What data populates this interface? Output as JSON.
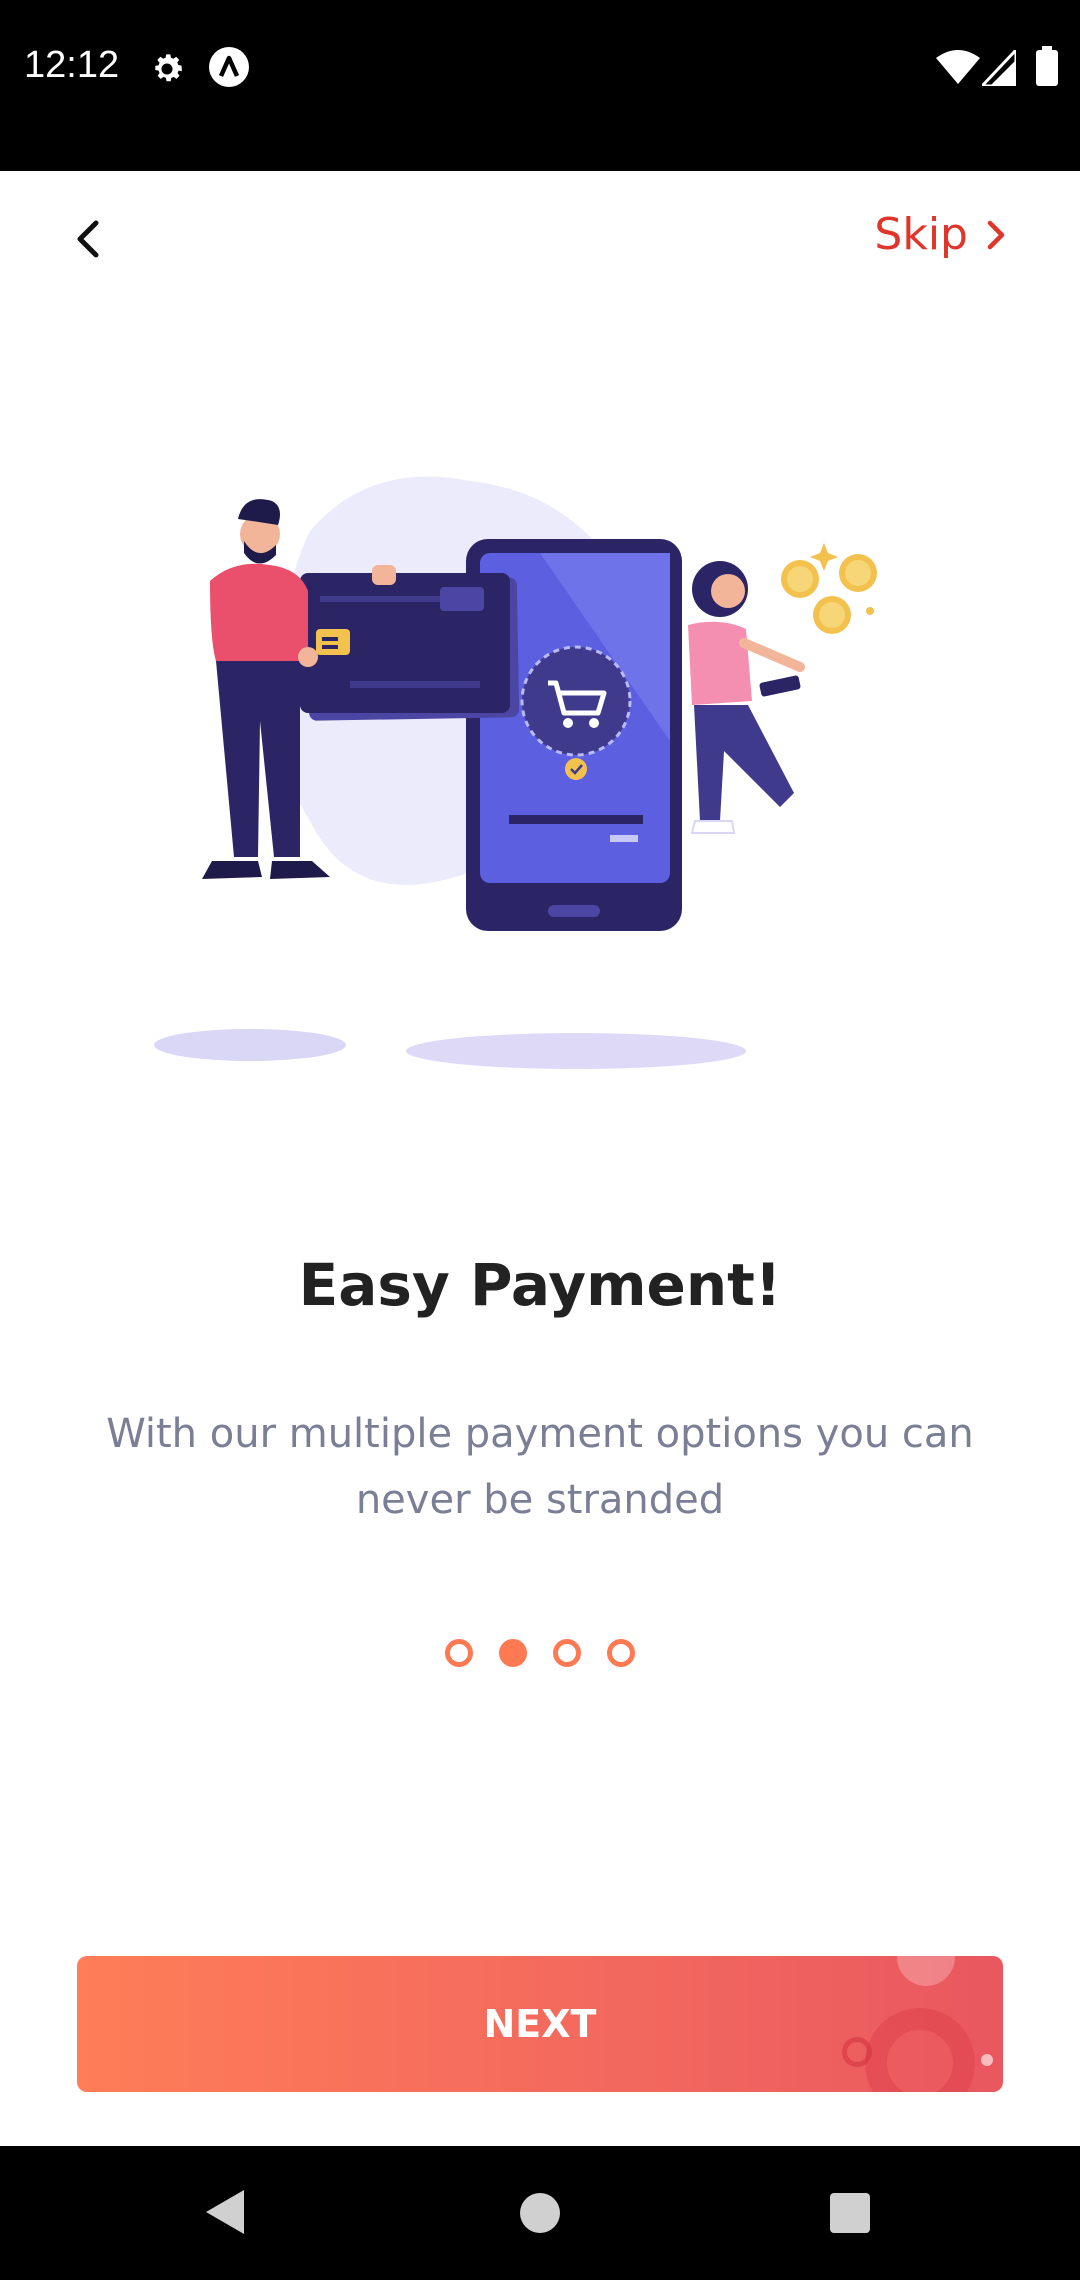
{
  "status_bar": {
    "time": "12:12",
    "icons": [
      "gear-icon",
      "app-logo-icon",
      "wifi-icon",
      "signal-icon",
      "battery-icon"
    ]
  },
  "header": {
    "back_icon": "chevron-left-icon",
    "skip_label": "Skip",
    "skip_icon": "chevron-right-icon"
  },
  "onboarding": {
    "title": "Easy Payment!",
    "subtitle": "With our multiple payment options you can never be stranded",
    "page_indicator": {
      "total": 4,
      "active_index": 1
    }
  },
  "next_button": {
    "label": "NEXT"
  },
  "nav_bar": {
    "icons": [
      "back-triangle-icon",
      "home-circle-icon",
      "recents-square-icon"
    ]
  },
  "colors": {
    "accent": "#ff7a52",
    "skip": "#e0352b",
    "title": "#222222",
    "subtitle": "#7b7f96",
    "illustration_purple": "#5b5fe0",
    "illustration_dark": "#2b2566"
  }
}
